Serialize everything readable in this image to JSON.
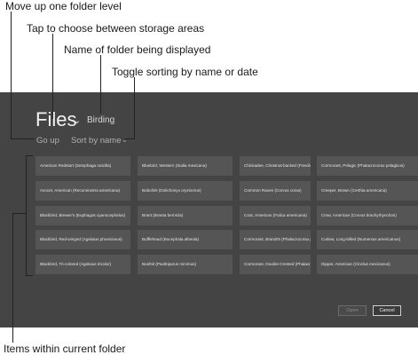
{
  "callouts": {
    "move_up": "Move up one folder level",
    "storage": "Tap to choose between storage areas",
    "folder_name": "Name of folder being displayed",
    "sorting": "Toggle sorting by name or date",
    "items": "Items within current folder"
  },
  "header": {
    "title": "Files",
    "folder": "Birding",
    "go_up": "Go up",
    "sort": "Sort by name"
  },
  "items": [
    [
      "American Redstart (Setophaga ruticilla)",
      "Bluebird, Western (Sialia mexicana)",
      "Chickadee, Chestnut-backed (Poecile rufescens)",
      "Cormorant, Pelagic (Phalacrocorax pelagicus)"
    ],
    [
      "Avocet, American (Recurvirostra americana)",
      "Bobolink (Dolichonyx oryzivorus)",
      "Common Raven (Corvus corax)",
      "Creeper, Brown (Certhia americana)"
    ],
    [
      "Blackbird, Brewer's (Euphagus cyanocephalus)",
      "Brant (Branta bernicla)",
      "Coot, American (Fulica americana)",
      "Crow, American (Corvus brachyrhynchos)"
    ],
    [
      "Blackbird, Red-winged (Agelaius phoeniceus)",
      "Bufflehead (Bucephala albeola)",
      "Cormorant, Brandt's (Phalacrocorax penicillatus)",
      "Curlew, Long-billed (Numenius americanus)"
    ],
    [
      "Blackbird, Tri-colored (Agelaius tricolor)",
      "Bushtit (Psaltriparus minimus)",
      "Cormorant, Double-Crested (Phalacrocorax auritus)",
      "Dipper, American (Cinclus mexicanus)"
    ]
  ],
  "buttons": {
    "open": "Open",
    "cancel": "Cancel"
  }
}
